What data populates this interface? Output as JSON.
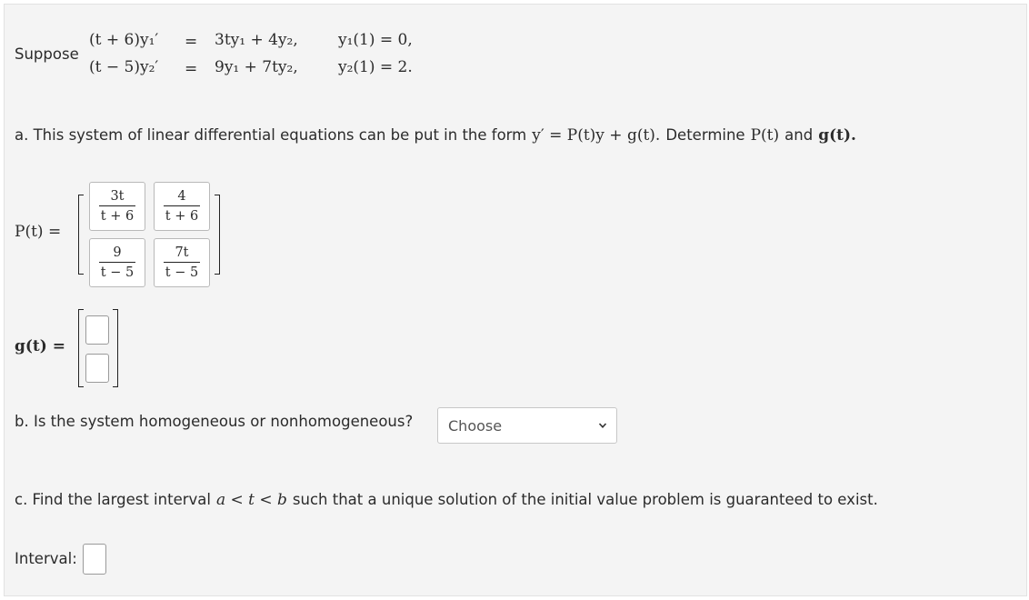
{
  "system": {
    "suppose_label": "Suppose",
    "row1": {
      "lhs": "(t + 6)y₁′",
      "eq": "=",
      "rhs": "3ty₁ + 4y₂,",
      "ic": "y₁(1) = 0,"
    },
    "row2": {
      "lhs": "(t − 5)y₂′",
      "eq": "=",
      "rhs": "9y₁ + 7ty₂,",
      "ic": "y₂(1) = 2."
    }
  },
  "part_a": {
    "text_before": "a. This system of linear differential equations can be put in the form",
    "form": "y′ = P(t)y + g(t).",
    "text_mid": "Determine",
    "p": "P(t)",
    "and_word": "and",
    "g": "g(t).",
    "p_label": "P(t) =",
    "p_matrix": [
      {
        "num": "3t",
        "den": "t + 6"
      },
      {
        "num": "4",
        "den": "t + 6"
      },
      {
        "num": "9",
        "den": "t − 5"
      },
      {
        "num": "7t",
        "den": "t − 5"
      }
    ],
    "g_label": "g(t) =",
    "g_values": [
      "",
      ""
    ]
  },
  "part_b": {
    "question": "b. Is the system homogeneous or nonhomogeneous?",
    "select_value": "Choose"
  },
  "part_c": {
    "text_before": "c. Find the largest interval",
    "interval_math": "a < t < b",
    "text_after": "such that a unique solution of the initial value problem is guaranteed to exist.",
    "interval_label": "Interval:",
    "interval_value": ""
  }
}
